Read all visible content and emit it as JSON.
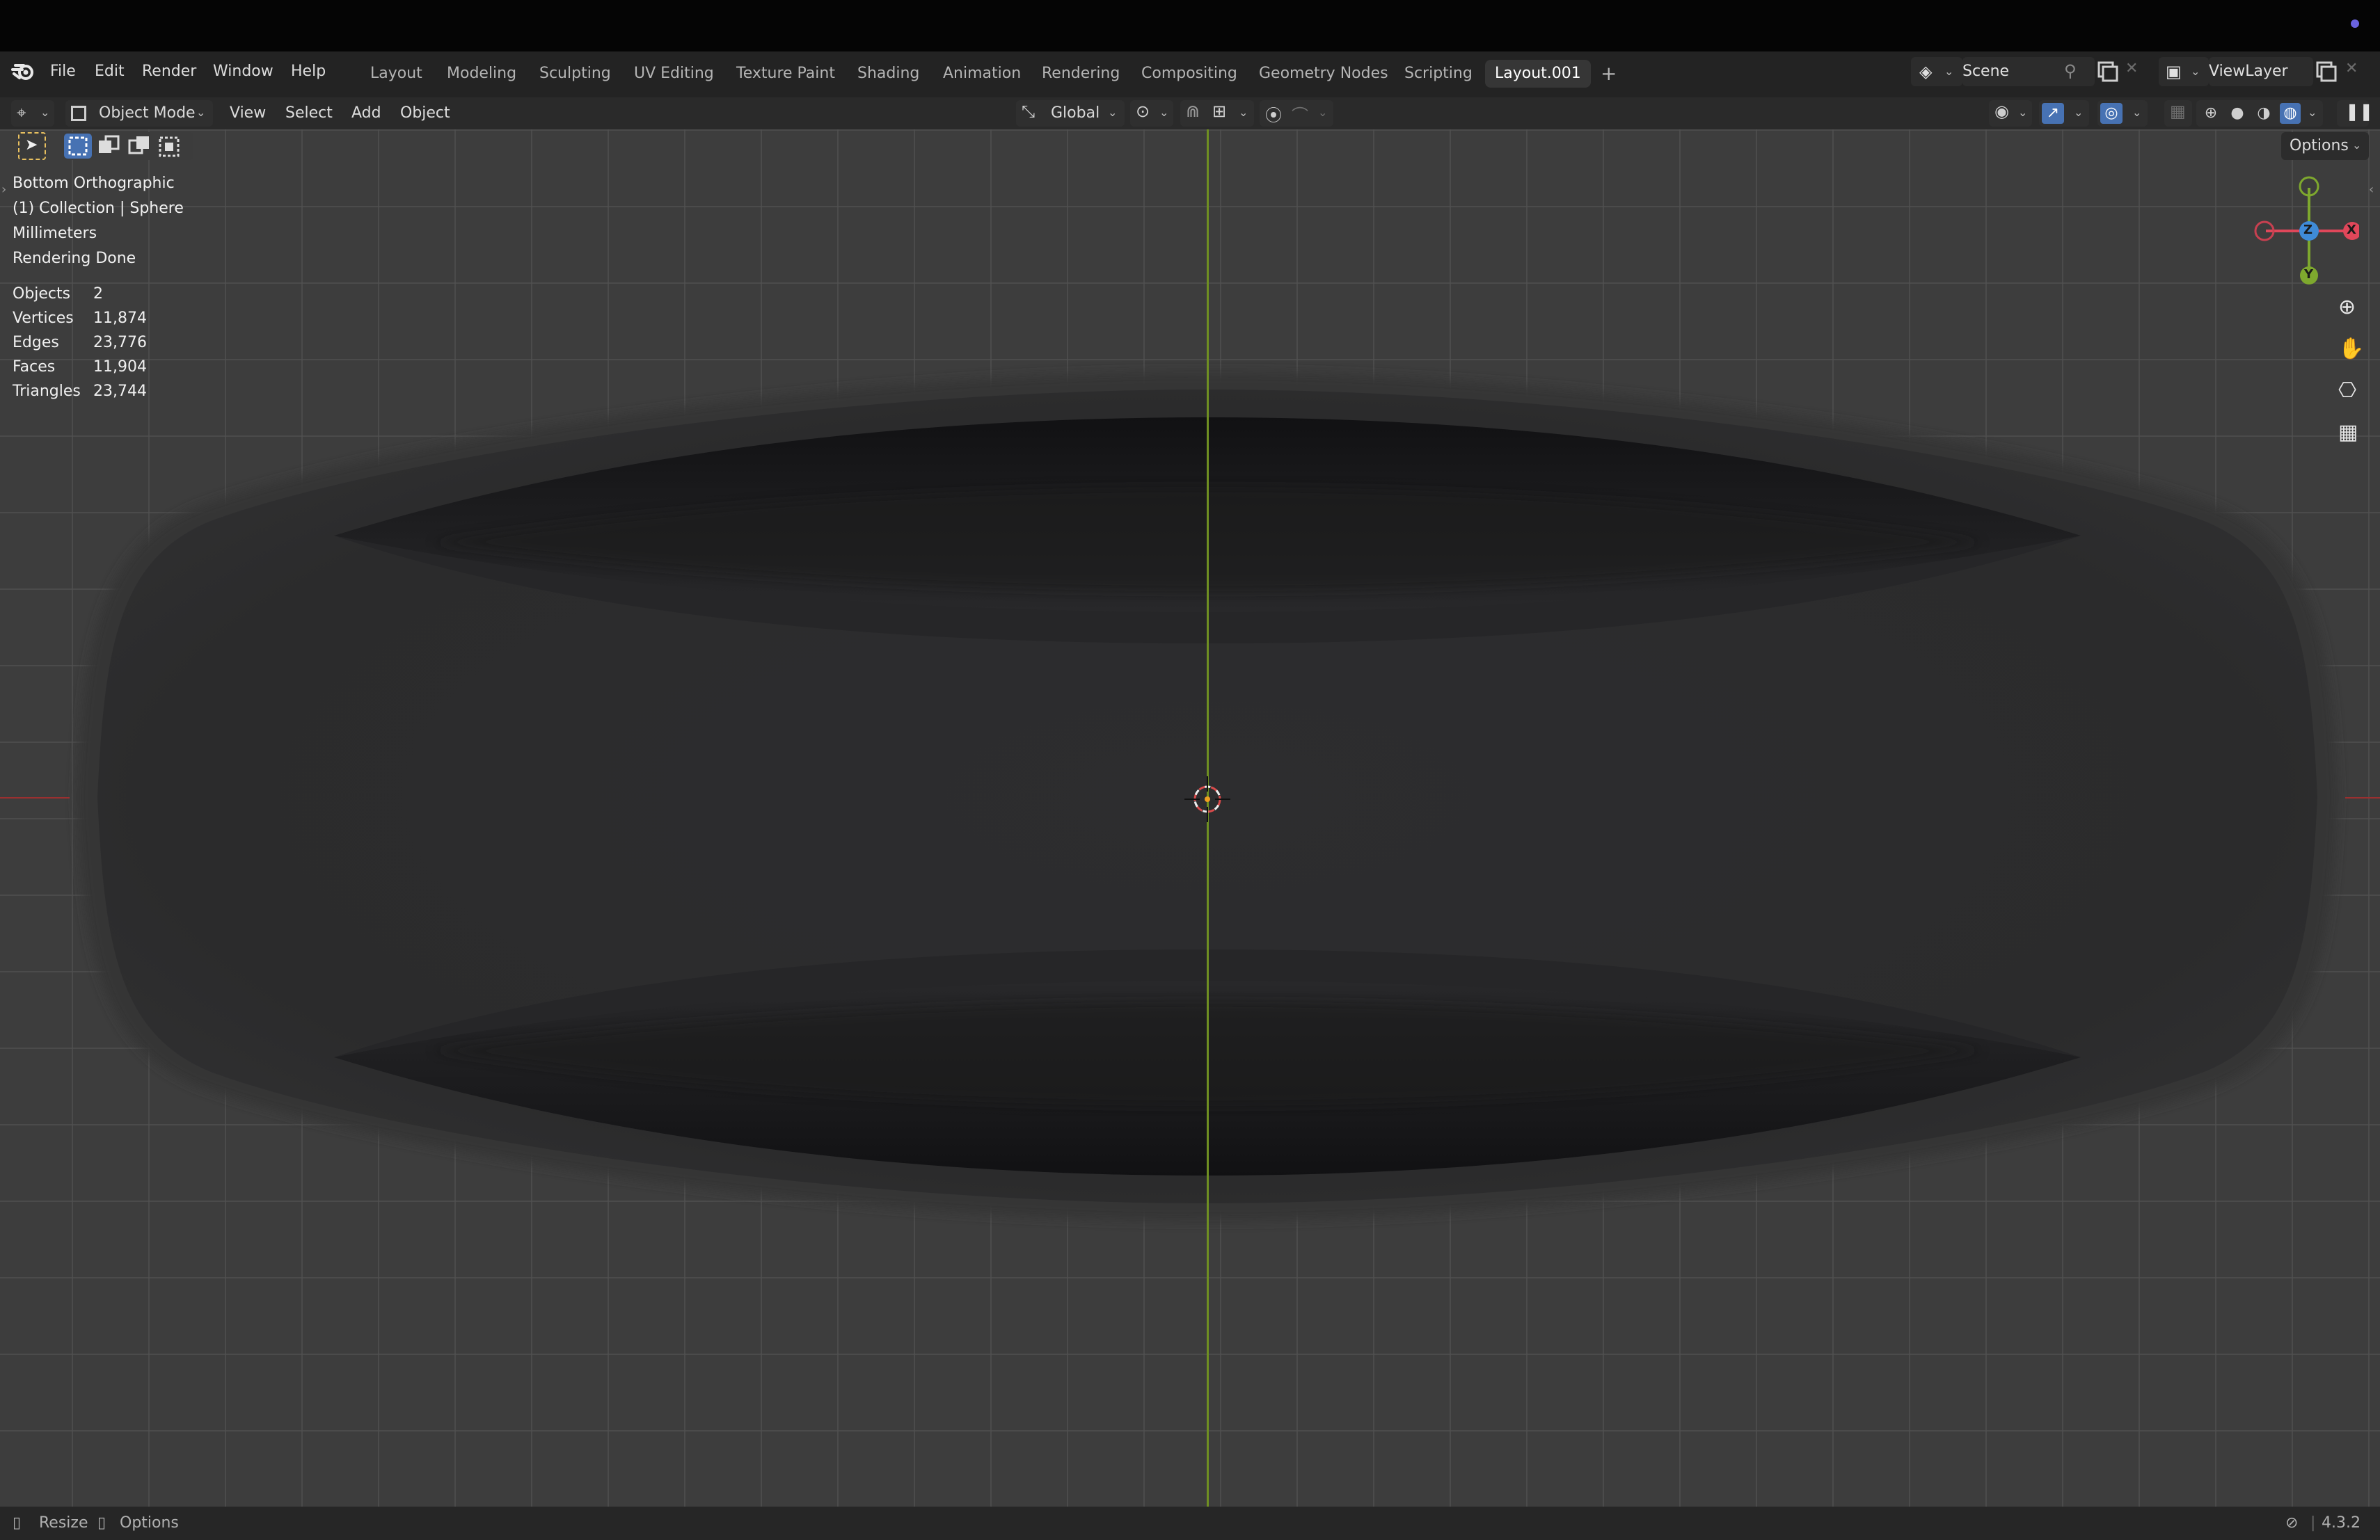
{
  "menu": {
    "file": "File",
    "edit": "Edit",
    "render": "Render",
    "window": "Window",
    "help": "Help"
  },
  "workspaces": [
    "Layout",
    "Modeling",
    "Sculpting",
    "UV Editing",
    "Texture Paint",
    "Shading",
    "Animation",
    "Rendering",
    "Compositing",
    "Geometry Nodes",
    "Scripting",
    "Layout.001"
  ],
  "active_workspace": "Layout.001",
  "add_workspace": "+",
  "scene": {
    "name": "Scene"
  },
  "view_layer": {
    "name": "ViewLayer"
  },
  "header": {
    "mode": "Object Mode",
    "view": "View",
    "select": "Select",
    "add": "Add",
    "object": "Object",
    "orientation": "Global",
    "options": "Options"
  },
  "viewport_info": {
    "view_name": "Bottom Orthographic",
    "collection": "(1) Collection | Sphere",
    "units": "Millimeters",
    "render_status": "Rendering Done"
  },
  "stats": [
    {
      "label": "Objects",
      "value": "2"
    },
    {
      "label": "Vertices",
      "value": "11,874"
    },
    {
      "label": "Edges",
      "value": "23,776"
    },
    {
      "label": "Faces",
      "value": "11,904"
    },
    {
      "label": "Triangles",
      "value": "23,744"
    }
  ],
  "gizmo": {
    "z": "Z",
    "x": "X",
    "y": "Y"
  },
  "statusbar": {
    "resize": "Resize",
    "options": "Options",
    "version": "4.3.2"
  },
  "icons": {
    "blender_logo": "blender-logo-icon",
    "editor_type": "3d-viewport-icon",
    "zoom": "zoom-icon",
    "pan": "hand-icon",
    "camera": "camera-icon",
    "ortho": "grid-icon"
  },
  "colors": {
    "x_axis": "#e0475a",
    "y_axis": "#7ea82e",
    "z_axis": "#3f8bd8",
    "active_accent": "#4772b3",
    "origin": "#f0a020"
  }
}
